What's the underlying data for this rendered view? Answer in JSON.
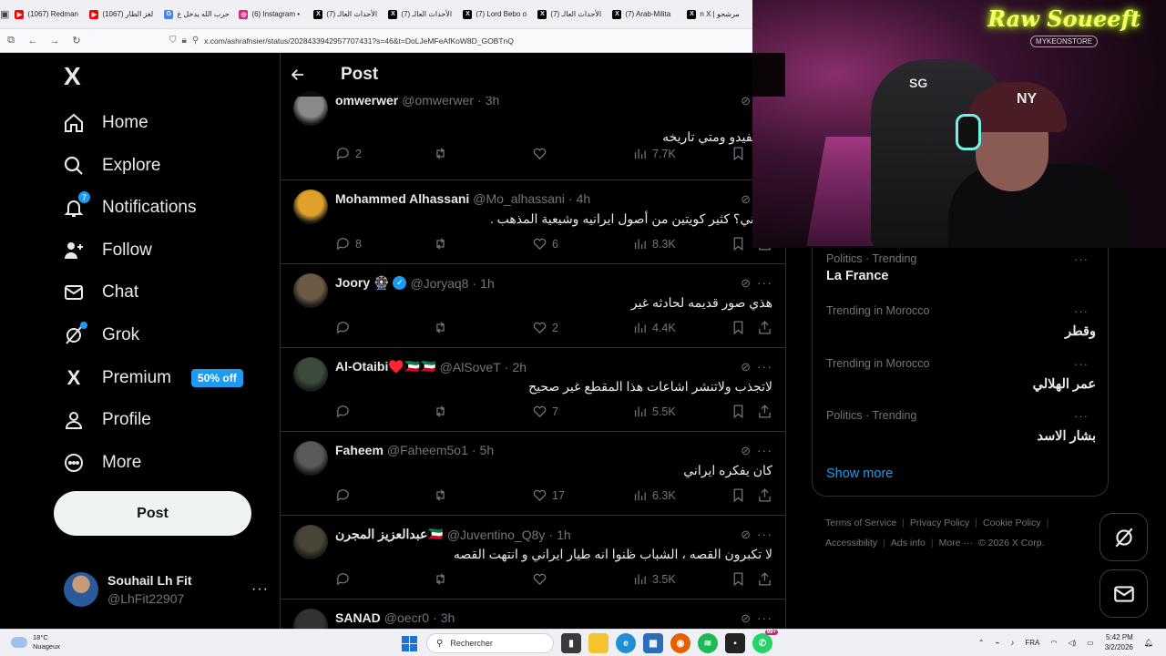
{
  "browser": {
    "tabs": [
      {
        "label": "(1067) Redman",
        "color": "#ff0000",
        "glyph": "▶"
      },
      {
        "label": "(1067) لغز الطار",
        "color": "#ff0000",
        "glyph": "▶"
      },
      {
        "label": "حرب الله يدخل ع",
        "color": "#4285f4",
        "glyph": "G"
      },
      {
        "label": "(6) Instagram •",
        "color": "#d62976",
        "glyph": "◎"
      },
      {
        "label": "(7) الأحداث العالـ",
        "color": "#000000",
        "glyph": "X"
      },
      {
        "label": "(7) الأحداث العالـ",
        "color": "#000000",
        "glyph": "X"
      },
      {
        "label": "(7) Lord Bebo o",
        "color": "#000000",
        "glyph": "X"
      },
      {
        "label": "(7) الأحداث العالـ",
        "color": "#000000",
        "glyph": "X"
      },
      {
        "label": "(7) Arab-Milita",
        "color": "#000000",
        "glyph": "X"
      },
      {
        "label": "n X | مرشحو",
        "color": "#000000",
        "glyph": "X"
      }
    ],
    "url": "x.com/ashrafnsier/status/2028433942957707431?s=46&t=DoLJeMFeAfKoW8D_GOBTnQ"
  },
  "sidebar": {
    "logo": "X",
    "items": [
      {
        "label": "Home",
        "icon": "home-icon"
      },
      {
        "label": "Explore",
        "icon": "search-icon"
      },
      {
        "label": "Notifications",
        "icon": "bell-icon",
        "badge": "7"
      },
      {
        "label": "Follow",
        "icon": "follow-icon"
      },
      {
        "label": "Chat",
        "icon": "mail-icon"
      },
      {
        "label": "Grok",
        "icon": "grok-icon"
      },
      {
        "label": "Premium",
        "icon": "x-icon",
        "pill": "50% off"
      },
      {
        "label": "Profile",
        "icon": "profile-icon"
      },
      {
        "label": "More",
        "icon": "more-circle-icon"
      }
    ],
    "post_label": "Post",
    "account": {
      "name": "Souhail Lh Fit",
      "handle": "@LhFit22907",
      "more": "···"
    }
  },
  "main": {
    "title": "Post",
    "tweets": [
      {
        "name": "omwerwer",
        "handle": "@omwerwer",
        "time": "3h",
        "text": "ذا الفيدو ومتي تاريخه",
        "mention": "@g",
        "replies": "2",
        "retweets": "",
        "likes": "",
        "views": "7.7K",
        "avatar_color": "#8a8a8a"
      },
      {
        "name": "Mohammed Alhassani",
        "handle": "@Mo_alhassani",
        "time": "4h",
        "text": "جنوني؟ كثير كويتين من أصول ايرانيه وشيعية المذهب .",
        "replies": "8",
        "retweets": "",
        "likes": "6",
        "views": "8.3K",
        "avatar_color": "#e0a12a"
      },
      {
        "name": "Joory 🎡",
        "handle": "@Joryaq8",
        "time": "1h",
        "text": "هذي صور قديمه لحادثه غير",
        "replies": "",
        "retweets": "",
        "likes": "2",
        "views": "4.4K",
        "avatar_color": "#6b5a44",
        "verified": true
      },
      {
        "name": "Al-Otaibi♥️🇰🇼🇰🇼",
        "handle": "@AlSoveT",
        "time": "2h",
        "text": "لاتجذب ولاتنشر اشاعات  هذا المقطع غير صحيح",
        "replies": "",
        "retweets": "",
        "likes": "7",
        "views": "5.5K",
        "avatar_color": "#3c4a3c"
      },
      {
        "name": "Faheem",
        "handle": "@Faheem5o1",
        "time": "5h",
        "text": "كان يفكره ايراني",
        "replies": "",
        "retweets": "",
        "likes": "17",
        "views": "6.3K",
        "avatar_color": "#5a5a5a"
      },
      {
        "name": "عبدالعزيز المجرن🇰🇼",
        "handle": "@Juventino_Q8y",
        "time": "1h",
        "text": "لا تكبرون القصه ، الشباب ظنوا انه طيار ايراني و انتهت القصه",
        "replies": "",
        "retweets": "",
        "likes": "",
        "views": "3.5K",
        "avatar_color": "#4a4436"
      },
      {
        "name": "SANAD",
        "handle": "@oecr0",
        "time": "3h",
        "text": "",
        "replies": "",
        "retweets": "",
        "likes": "",
        "views": "",
        "avatar_color": "#333333"
      }
    ]
  },
  "right": {
    "trends": [
      {
        "category": "Politics · Trending",
        "name": "La France",
        "rtl": false
      },
      {
        "category": "Trending in Morocco",
        "name": "وقطر",
        "rtl": true
      },
      {
        "category": "Trending in Morocco",
        "name": "عمر الهلالي",
        "rtl": true
      },
      {
        "category": "Politics · Trending",
        "name": "بشار الاسد",
        "rtl": true
      }
    ],
    "show_more": "Show more",
    "footer": [
      "Terms of Service",
      "Privacy Policy",
      "Cookie Policy",
      "Accessibility",
      "Ads info",
      "More ···",
      "© 2026 X Corp."
    ]
  },
  "webcam": {
    "sign_line1": "Raw Soueeft",
    "sign_line2": "MYKEONSTORE",
    "chair_logo": "SG",
    "cap_logo": "NY"
  },
  "taskbar": {
    "weather_temp": "18°C",
    "weather_desc": "Nuageux",
    "search_placeholder": "Rechercher",
    "lang": "FRA",
    "time": "5:42 PM",
    "date": "3/2/2026",
    "whatsapp_badge": "99+"
  },
  "colors": {
    "accent": "#1d9bf0",
    "bg": "#000000",
    "border": "#2f3336",
    "muted": "#71767b",
    "text": "#e7e9ea"
  }
}
